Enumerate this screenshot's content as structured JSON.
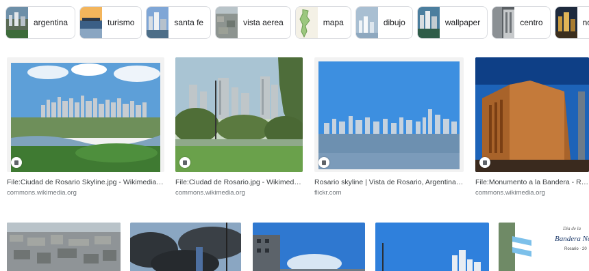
{
  "chips": [
    {
      "label": "argentina"
    },
    {
      "label": "turismo"
    },
    {
      "label": "santa fe"
    },
    {
      "label": "vista aerea"
    },
    {
      "label": "mapa"
    },
    {
      "label": "dibujo"
    },
    {
      "label": "wallpaper"
    },
    {
      "label": "centro"
    },
    {
      "label": "noche"
    }
  ],
  "results": [
    {
      "caption": "File:Ciudad de Rosario Skyline.jpg - Wikimedia Commons",
      "source": "commons.wikimedia.org"
    },
    {
      "caption": "File:Ciudad de Rosario.jpg - Wikimedia Commons",
      "source": "commons.wikimedia.org"
    },
    {
      "caption": "Rosario skyline | Vista de Rosario, Argentina, desde el Ba...",
      "source": "flickr.com"
    },
    {
      "caption": "File:Monumento a la Bandera - Rosario.jpg - Wikimedia Commons",
      "source": "commons.wikimedia.org"
    }
  ],
  "bottom_row": {
    "banner_text": "Bandera No",
    "banner_script": "Dia de la",
    "banner_sub": "Rosario · 20"
  }
}
